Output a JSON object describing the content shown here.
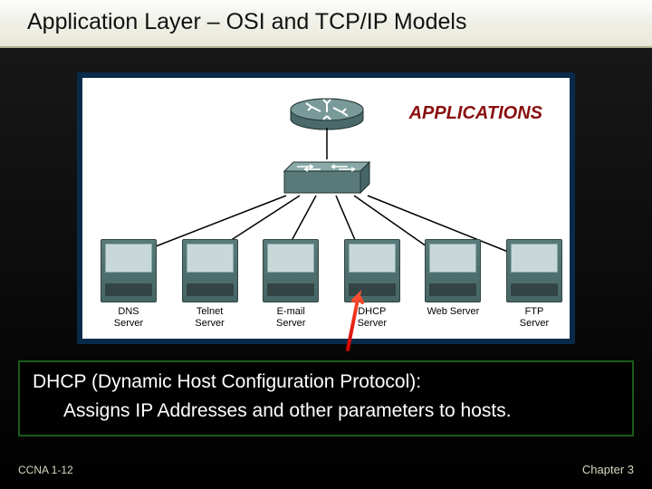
{
  "title": "Application Layer – OSI and TCP/IP Models",
  "diagram": {
    "heading": "APPLICATIONS",
    "servers": [
      {
        "label": "DNS\nServer"
      },
      {
        "label": "Telnet\nServer"
      },
      {
        "label": "E-mail\nServer"
      },
      {
        "label": "DHCP\nServer"
      },
      {
        "label": "Web Server"
      },
      {
        "label": "FTP\nServer"
      }
    ],
    "highlighted_server_index": 3,
    "devices": {
      "top": "router-icon",
      "middle": "switch-icon"
    }
  },
  "callout": {
    "line1": "DHCP (Dynamic Host Configuration Protocol):",
    "line2": "Assigns IP Addresses and other parameters to hosts."
  },
  "footer": {
    "left": "CCNA 1-12",
    "right": "Chapter 3"
  }
}
